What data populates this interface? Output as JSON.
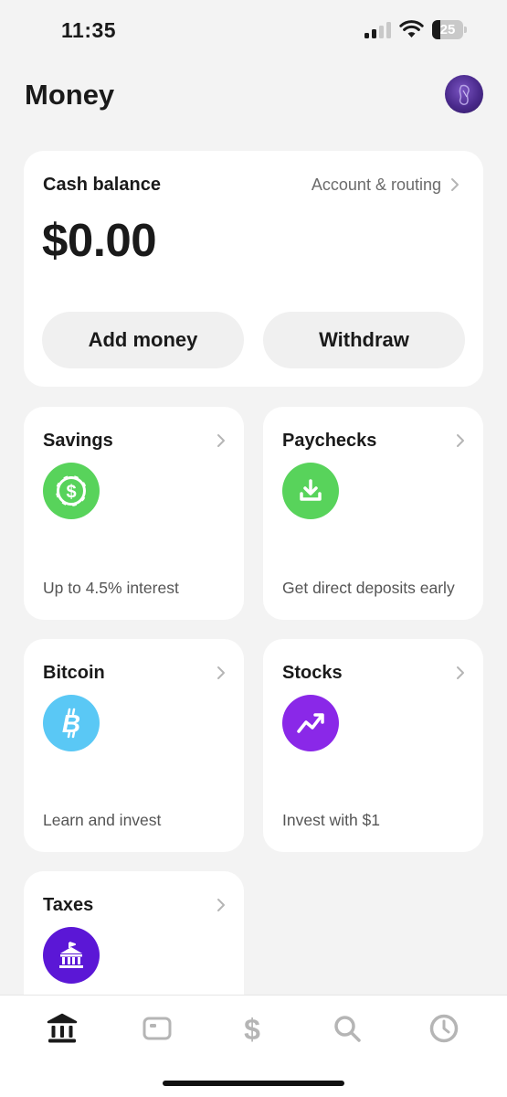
{
  "status_bar": {
    "time": "11:35",
    "battery": "25",
    "battery_level": 0.25
  },
  "header": {
    "title": "Money"
  },
  "balance": {
    "label": "Cash balance",
    "routing_link": "Account & routing",
    "amount": "$0.00",
    "add_label": "Add money",
    "withdraw_label": "Withdraw"
  },
  "tiles": [
    {
      "title": "Savings",
      "subtitle": "Up to 4.5% interest",
      "icon": "dollar-circle-icon",
      "color": "#58d35b"
    },
    {
      "title": "Paychecks",
      "subtitle": "Get direct deposits early",
      "icon": "download-icon",
      "color": "#58d35b"
    },
    {
      "title": "Bitcoin",
      "subtitle": "Learn and invest",
      "icon": "bitcoin-icon",
      "color": "#5ac8f5"
    },
    {
      "title": "Stocks",
      "subtitle": "Invest with $1",
      "icon": "trend-up-icon",
      "color": "#8a28e8"
    },
    {
      "title": "Taxes",
      "subtitle": "",
      "icon": "bank-icon",
      "color": "#5b17d6"
    }
  ],
  "nav": [
    {
      "name": "home-icon",
      "active": true
    },
    {
      "name": "card-icon",
      "active": false
    },
    {
      "name": "dollar-icon",
      "active": false
    },
    {
      "name": "search-icon",
      "active": false
    },
    {
      "name": "clock-icon",
      "active": false
    }
  ],
  "colors": {
    "background": "#f3f3f3",
    "card": "#ffffff",
    "active_nav": "#1a1a1a",
    "inactive_nav": "#b5b5b5"
  }
}
